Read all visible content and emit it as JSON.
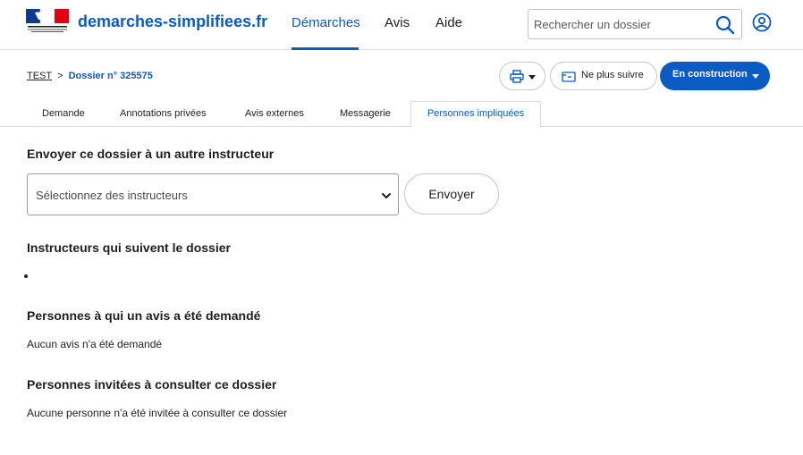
{
  "header": {
    "site_title": "demarches-simplifiees.fr",
    "nav": {
      "demarches": "Démarches",
      "avis": "Avis",
      "aide": "Aide"
    },
    "search": {
      "placeholder": "Rechercher un dossier"
    },
    "colors": {
      "accent": "#0a5bc4"
    }
  },
  "breadcrumb": {
    "root": "TEST",
    "separator": ">",
    "current": "Dossier n° 325575"
  },
  "actions": {
    "print_icon": "printer-icon",
    "follow_label": "Ne plus suivre",
    "state_label": "En construction"
  },
  "tabs": {
    "demande": "Demande",
    "annotations": "Annotations privées",
    "avis_externes": "Avis externes",
    "messagerie": "Messagerie",
    "personnes": "Personnes impliquées"
  },
  "main": {
    "send_title": "Envoyer ce dossier à un autre instructeur",
    "select_placeholder": "Sélectionnez des instructeurs",
    "send_button": "Envoyer",
    "followers_title": "Instructeurs qui suivent le dossier",
    "avis_title": "Personnes à qui un avis a été demandé",
    "avis_empty": "Aucun avis n'a été demandé",
    "invites_title": "Personnes invitées à consulter ce dossier",
    "invites_empty": "Aucune personne n'a été invitée à consulter ce dossier"
  }
}
